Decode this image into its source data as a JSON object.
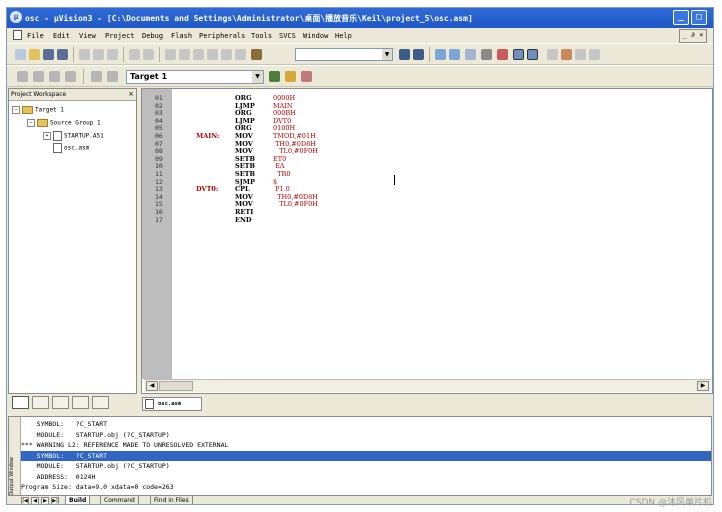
{
  "window": {
    "title": "osc - µVision3 - [C:\\Documents and Settings\\Administrator\\桌面\\播放音乐\\Keil\\project_5\\osc.asm]",
    "min_glyph": "_",
    "max_glyph": "□"
  },
  "menubar": {
    "items": [
      "File",
      "Edit",
      "View",
      "Project",
      "Debug",
      "Flash",
      "Peripherals",
      "Tools",
      "SVCS",
      "Window",
      "Help"
    ],
    "mdi_controls": "_ ∂ ×"
  },
  "toolbar": {
    "target": "Target 1"
  },
  "workspace": {
    "title": "Project Workspace",
    "close": "×",
    "tree": [
      {
        "label": "Target 1",
        "kind": "target",
        "expander": "−"
      },
      {
        "label": "Source Group 1",
        "kind": "group",
        "expander": "−"
      },
      {
        "label": "STARTUP.A51",
        "kind": "file",
        "expander": "+"
      },
      {
        "label": "osc.asm",
        "kind": "file",
        "expander": ""
      }
    ]
  },
  "editor": {
    "tab_label": "osc.asm",
    "lines": [
      {
        "no": "01",
        "label": "",
        "mnem": "ORG",
        "op": "0000H"
      },
      {
        "no": "02",
        "label": "",
        "mnem": "LJMP",
        "op": "MAIN"
      },
      {
        "no": "03",
        "label": "",
        "mnem": "ORG",
        "op": "000BH"
      },
      {
        "no": "04",
        "label": "",
        "mnem": "LJMP",
        "op": "DVT0"
      },
      {
        "no": "05",
        "label": "",
        "mnem": "ORG",
        "op": "0100H"
      },
      {
        "no": "06",
        "label": "MAIN:",
        "mnem": "MOV",
        "op": "TMOD,#01H"
      },
      {
        "no": "07",
        "label": "",
        "mnem": "MOV",
        "op": " TH0,#0D8H"
      },
      {
        "no": "08",
        "label": "",
        "mnem": "MOV",
        "op": "   TL0,#0F0H"
      },
      {
        "no": "09",
        "label": "",
        "mnem": "SETB",
        "op": "ET0"
      },
      {
        "no": "10",
        "label": "",
        "mnem": "SETB",
        "op": " EA"
      },
      {
        "no": "11",
        "label": "",
        "mnem": "SETB",
        "op": "  TR0"
      },
      {
        "no": "12",
        "label": "",
        "mnem": "SJMP",
        "op": "$"
      },
      {
        "no": "13",
        "label": "DVT0:",
        "mnem": "CPL",
        "op": " P1.0"
      },
      {
        "no": "14",
        "label": "",
        "mnem": "MOV",
        "op": "  TH0,#0D8H"
      },
      {
        "no": "15",
        "label": "",
        "mnem": "MOV",
        "op": "   TL0,#0F0H"
      },
      {
        "no": "16",
        "label": "",
        "mnem": "RETI",
        "op": ""
      },
      {
        "no": "17",
        "label": "",
        "mnem": "END",
        "op": ""
      }
    ]
  },
  "output": {
    "side_label": "Output Window",
    "lines": [
      {
        "text": "    SYMBOL:   ?C_START",
        "selected": false
      },
      {
        "text": "    MODULE:   STARTUP.obj (?C_STARTUP)",
        "selected": false
      },
      {
        "text": "*** WARNING L2: REFERENCE MADE TO UNRESOLVED EXTERNAL",
        "selected": false
      },
      {
        "text": "    SYMBOL:   ?C_START",
        "selected": true
      },
      {
        "text": "    MODULE:   STARTUP.obj (?C_STARTUP)",
        "selected": false
      },
      {
        "text": "    ADDRESS:  0124H",
        "selected": false
      },
      {
        "text": "Program Size: data=9.0 xdata=0 code=263",
        "selected": false
      }
    ],
    "tabs": [
      "Build",
      "Command",
      "Find in Files"
    ]
  },
  "watermark": "CSDN @沐风单片机"
}
